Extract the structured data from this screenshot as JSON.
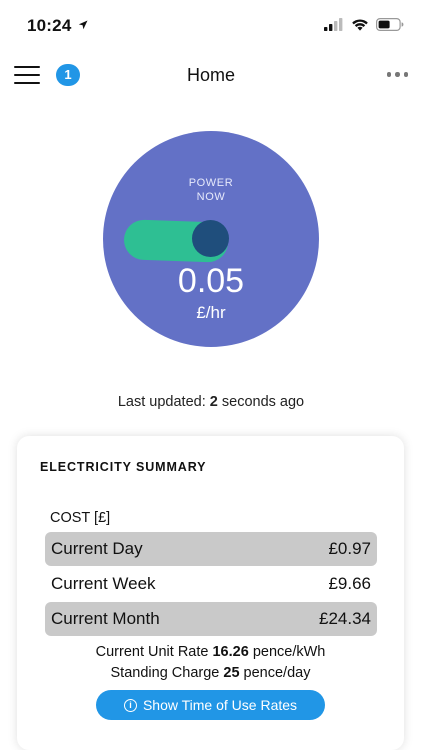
{
  "status_bar": {
    "time": "10:24"
  },
  "nav": {
    "notification_count": "1",
    "title": "Home"
  },
  "power": {
    "label_line1": "POWER",
    "label_line2": "NOW",
    "value": "0.05",
    "unit": "£/hr"
  },
  "last_updated": {
    "prefix": "Last updated:",
    "value": "2",
    "suffix": "seconds ago"
  },
  "summary": {
    "title": "ELECTRICITY SUMMARY",
    "cost_header": "COST [£]",
    "rows": [
      {
        "label": "Current Day",
        "value": "£0.97"
      },
      {
        "label": "Current Week",
        "value": "£9.66"
      },
      {
        "label": "Current Month",
        "value": "£24.34"
      }
    ],
    "unit_rate": {
      "prefix": "Current Unit Rate",
      "value": "16.26",
      "suffix": "pence/kWh"
    },
    "standing_charge": {
      "prefix": "Standing Charge",
      "value": "25",
      "suffix": "pence/day"
    },
    "tou_button_label": "Show Time of Use Rates"
  },
  "colors": {
    "accent": "#2196e6",
    "power_circle": "#6371c6",
    "toggle_green": "#2ebf93",
    "toggle_knob": "#1f4e7c",
    "row_shade": "#c9c9c9"
  }
}
